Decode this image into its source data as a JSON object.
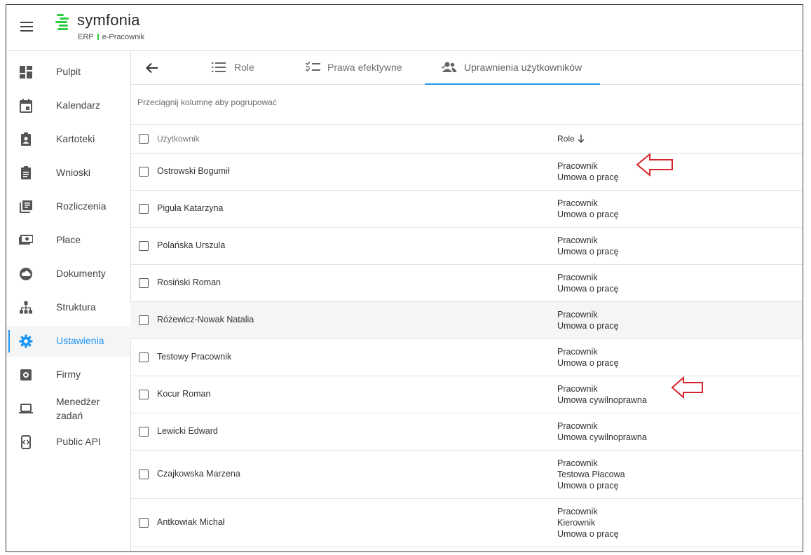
{
  "app": {
    "brand": "symfonia",
    "product": "ERP",
    "module": "e-Pracownik",
    "brand_color": "#2ecc40",
    "accent_color": "#2196f3"
  },
  "sidebar": {
    "items": [
      {
        "label": "Pulpit",
        "icon": "dashboard-icon"
      },
      {
        "label": "Kalendarz",
        "icon": "calendar-icon"
      },
      {
        "label": "Kartoteki",
        "icon": "contact-card-icon"
      },
      {
        "label": "Wnioski",
        "icon": "clipboard-icon"
      },
      {
        "label": "Rozliczenia",
        "icon": "library-books-icon"
      },
      {
        "label": "Płace",
        "icon": "money-icon"
      },
      {
        "label": "Dokumenty",
        "icon": "cloud-icon"
      },
      {
        "label": "Struktura",
        "icon": "org-chart-icon"
      },
      {
        "label": "Ustawienia",
        "icon": "gear-icon",
        "active": true
      },
      {
        "label": "Firmy",
        "icon": "company-icon"
      },
      {
        "label": "Menedżer zadań",
        "icon": "laptop-icon"
      },
      {
        "label": "Public API",
        "icon": "api-icon"
      }
    ]
  },
  "tabs": [
    {
      "label": "Role",
      "icon": "list-icon"
    },
    {
      "label": "Prawa efektywne",
      "icon": "checklist-icon"
    },
    {
      "label": "Uprawnienia użytkowników",
      "icon": "users-icon",
      "active": true
    }
  ],
  "grid": {
    "group_hint": "Przeciągnij kolumnę aby pogrupować",
    "columns": {
      "user": "Użytkownik",
      "role": "Role"
    },
    "sort": {
      "column": "Role",
      "direction": "descending"
    },
    "rows": [
      {
        "name": "Ostrowski Bogumił",
        "roles": [
          "Pracownik",
          "Umowa o pracę"
        ]
      },
      {
        "name": "Piguła Katarzyna",
        "roles": [
          "Pracownik",
          "Umowa o pracę"
        ]
      },
      {
        "name": "Polańska Urszula",
        "roles": [
          "Pracownik",
          "Umowa o pracę"
        ]
      },
      {
        "name": "Rosiński Roman",
        "roles": [
          "Pracownik",
          "Umowa o pracę"
        ]
      },
      {
        "name": "Różewicz-Nowak Natalia",
        "roles": [
          "Pracownik",
          "Umowa o pracę"
        ],
        "hovered": true
      },
      {
        "name": "Testowy Pracownik",
        "roles": [
          "Pracownik",
          "Umowa o pracę"
        ]
      },
      {
        "name": "Kocur Roman",
        "roles": [
          "Pracownik",
          "Umowa cywilnoprawna"
        ]
      },
      {
        "name": "Lewicki Edward",
        "roles": [
          "Pracownik",
          "Umowa cywilnoprawna"
        ]
      },
      {
        "name": "Czajkowska Marzena",
        "roles": [
          "Pracownik",
          "Testowa Płacowa",
          "Umowa o pracę"
        ]
      },
      {
        "name": "Antkowiak Michał",
        "roles": [
          "Pracownik",
          "Kierownik",
          "Umowa o pracę"
        ]
      }
    ]
  },
  "annotations": {
    "arrow_color": "#d9232a"
  }
}
